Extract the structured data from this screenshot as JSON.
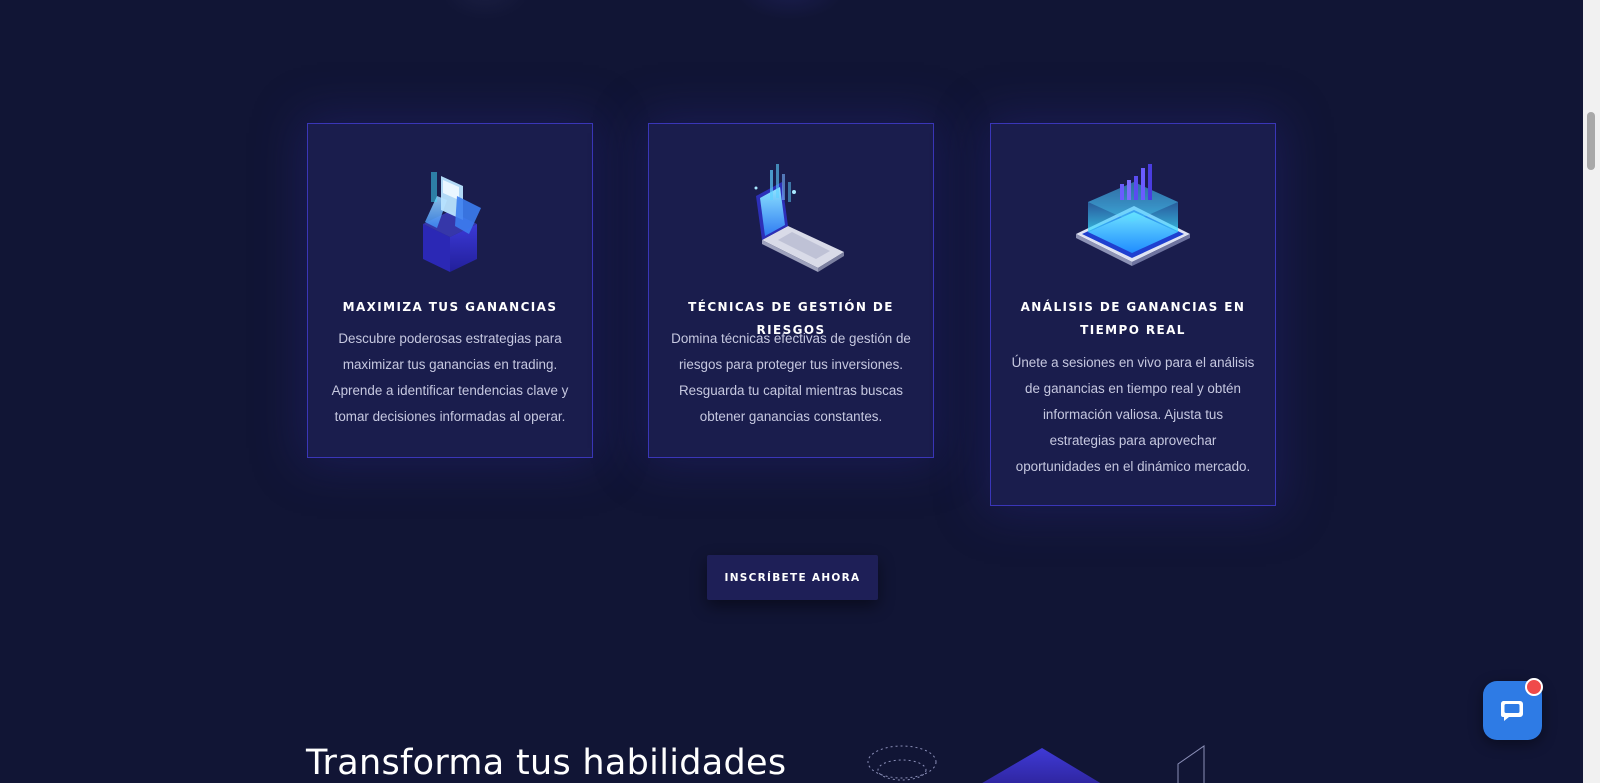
{
  "features": {
    "cards": [
      {
        "title": "MAXIMIZA TUS GANANCIAS",
        "description": "Descubre poderosas estrategias para maximizar tus ganancias en trading. Aprende a identificar tendencias clave y tomar decisiones informadas al operar.",
        "icon": "isometric-box-icon"
      },
      {
        "title": "TÉCNICAS DE GESTIÓN DE RIESGOS",
        "description": "Domina técnicas efectivas de gestión de riesgos para proteger tus inversiones. Resguarda tu capital mientras buscas obtener ganancias constantes.",
        "icon": "laptop-chart-icon"
      },
      {
        "title": "ANÁLISIS DE GANANCIAS EN TIEMPO REAL",
        "description": "Únete a sesiones en vivo para el análisis de ganancias en tiempo real y obtén información valiosa. Ajusta tus estrategias para aprovechar oportunidades en el dinámico mercado.",
        "icon": "tablet-chart-icon"
      }
    ]
  },
  "cta": {
    "label": "INSCRÍBETE AHORA"
  },
  "next_section": {
    "heading": "Transforma tus habilidades"
  },
  "chat": {
    "icon": "chat-bubble-icon",
    "badge_color": "#f04a4a",
    "button_color": "#2e7be5"
  },
  "colors": {
    "background": "#111535",
    "card_background": "#1a1d4d",
    "card_border": "#3a36b8"
  }
}
